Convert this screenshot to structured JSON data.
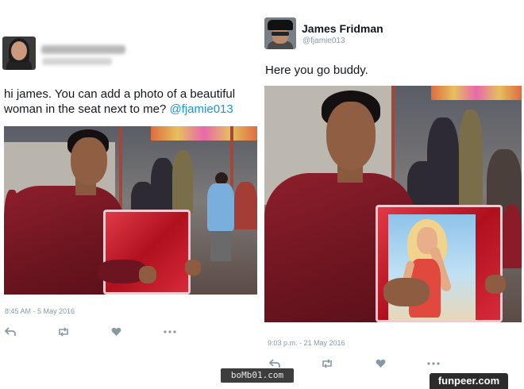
{
  "left_tweet": {
    "text_main": "hi james. You can add a photo of a beautiful woman in the seat next to me? ",
    "mention": "@fjamie013",
    "timestamp": "8:45 AM - 5 May 2016",
    "actions": [
      "reply-icon",
      "retweet-icon",
      "like-icon",
      "more-icon"
    ]
  },
  "right_tweet": {
    "display_name": "James Fridman",
    "handle": "@fjamie013",
    "text": "Here you go buddy.",
    "timestamp": "9:03 p.m. - 21 May 2016",
    "actions": [
      "reply-icon",
      "retweet-icon",
      "like-icon",
      "more-icon"
    ]
  },
  "watermarks": {
    "bomb": "boMb01.com",
    "funpeer": "funpeer.com"
  },
  "colors": {
    "mention": "#1b95e0",
    "meta_gray": "#8899a6",
    "text": "#14171a"
  }
}
